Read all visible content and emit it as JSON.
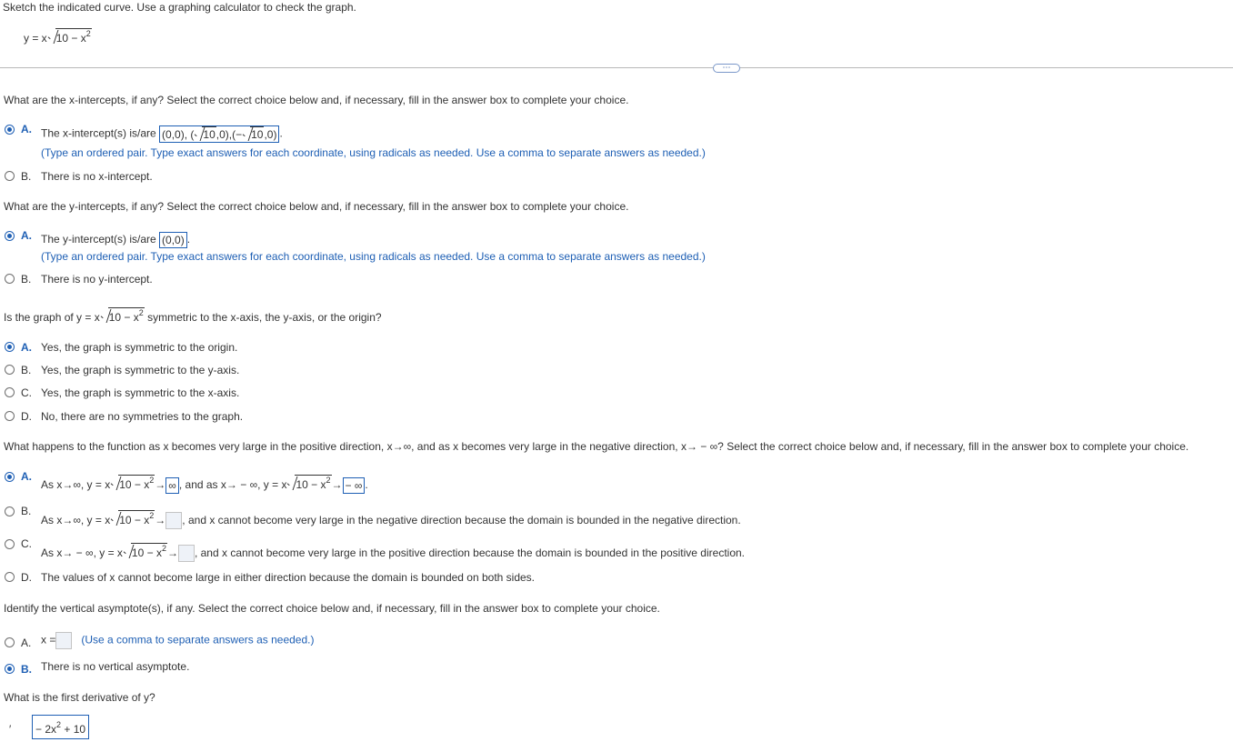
{
  "header": {
    "instruction": "Sketch the indicated curve. Use a graphing calculator to check the graph.",
    "equation": {
      "lhs": "y = x",
      "radicand": "10 − x",
      "exp": "2"
    }
  },
  "more_button": "⋯",
  "q1": {
    "prompt": "What are the x-intercepts, if any? Select the correct choice below and, if necessary, fill in the answer box to complete your choice.",
    "a_letter": "A.",
    "a_text": "The x-intercept(s) is/are",
    "a_answer_p1": "(0,0),",
    "a_answer_r1": "10",
    "a_answer_p2": ",0),(−",
    "a_answer_r2": "10",
    "a_answer_p3": ",0)",
    "a_hint": "(Type an ordered pair. Type exact answers for each coordinate, using radicals as needed. Use a comma to separate answers as needed.)",
    "b_letter": "B.",
    "b_text": "There is no x-intercept."
  },
  "q2": {
    "prompt": "What are the y-intercepts, if any? Select the correct choice below and, if necessary, fill in the answer box to complete your choice.",
    "a_letter": "A.",
    "a_text": "The y-intercept(s) is/are",
    "a_answer": "(0,0)",
    "a_hint": "(Type an ordered pair. Type exact answers for each coordinate, using radicals as needed. Use a comma to separate answers as needed.)",
    "b_letter": "B.",
    "b_text": "There is no y-intercept."
  },
  "q3": {
    "prompt_pre": "Is the graph of y = x",
    "radicand": "10 − x",
    "exp": "2",
    "prompt_post": "symmetric to the x-axis, the y-axis, or the origin?",
    "options": [
      {
        "letter": "A.",
        "text": "Yes, the graph is symmetric to the origin."
      },
      {
        "letter": "B.",
        "text": "Yes, the graph is symmetric to the y-axis."
      },
      {
        "letter": "C.",
        "text": "Yes, the graph is symmetric to the x-axis."
      },
      {
        "letter": "D.",
        "text": "No, there are no symmetries to the graph."
      }
    ]
  },
  "q4": {
    "prompt": "What happens to the function as x becomes very large in the positive direction, x→∞, and as x becomes very large in the negative direction, x→ − ∞? Select the correct choice below and, if necessary, fill in the answer box to complete your choice.",
    "a_letter": "A.",
    "a_pre": "As x→∞, y = x",
    "radicand": "10 − x",
    "exp": "2",
    "arrow": "→",
    "a_ans1": "∞",
    "a_mid": ", and as x→ − ∞, y = x",
    "a_ans2": "− ∞",
    "b_letter": "B.",
    "b_pre": "As x→∞, y = x",
    "b_post": ", and x cannot become very large in the negative direction because the domain is bounded in the negative direction.",
    "c_letter": "C.",
    "c_pre": "As x→ − ∞, y = x",
    "c_post": ", and x cannot become very large in the positive direction because the domain is bounded in the positive direction.",
    "d_letter": "D.",
    "d_text": "The values of x cannot become large in either direction because the domain is bounded on both sides."
  },
  "q5": {
    "prompt": "Identify the vertical asymptote(s), if any. Select the correct choice below and, if necessary, fill in the answer box to complete your choice.",
    "a_letter": "A.",
    "a_pre": "x =",
    "a_hint": "(Use a comma to separate answers as needed.)",
    "b_letter": "B.",
    "b_text": "There is no vertical asymptote."
  },
  "q6": {
    "prompt": "What is the first derivative of y?",
    "prime": "′",
    "answer_pre": "− 2x",
    "answer_exp": "2",
    "answer_post": "+ 10"
  }
}
